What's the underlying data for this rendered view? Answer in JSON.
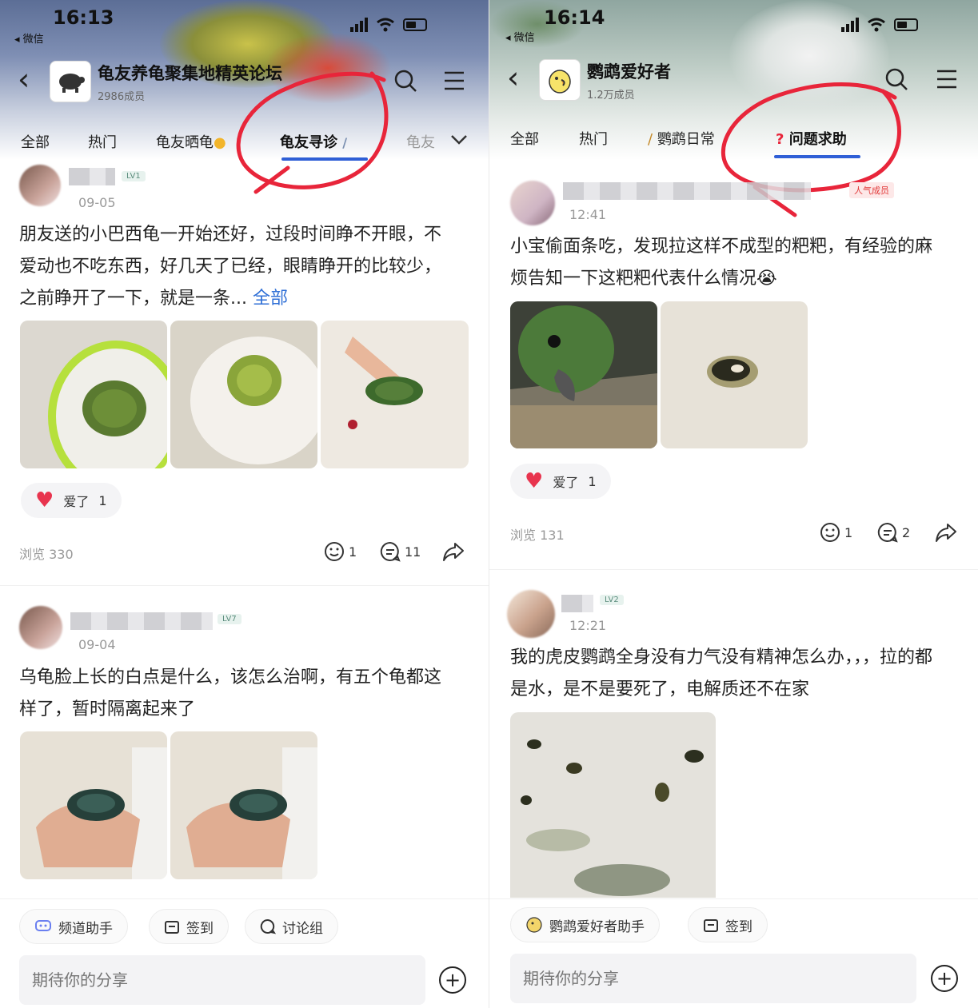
{
  "left": {
    "status": {
      "time": "16:13",
      "back_app": "◂ 微信"
    },
    "group": {
      "name": "龟友养龟聚集地精英论坛",
      "members": "2986成员",
      "avatar_icon": "turtle-logo-icon"
    },
    "tabs": [
      "全部",
      "热门",
      "龟友晒龟",
      "龟友寻诊",
      "龟友"
    ],
    "active_tab_index": 3,
    "posts": [
      {
        "level": "LV1",
        "time": "09-05",
        "text": "朋友送的小巴西龟一开始还好，过段时间睁不开眼，不爱动也不吃东西，好几天了已经，眼睛睁开的比较少，之前睁开了一下，就是一条...",
        "more": "全部",
        "like_label": "爱了",
        "like_count": "1",
        "views": "浏览 330",
        "reactions": "1",
        "comments": "11"
      },
      {
        "level": "LV7",
        "time": "09-04",
        "text": "乌龟脸上长的白点是什么，该怎么治啊，有五个龟都这样了，暂时隔离起来了"
      }
    ],
    "bottom": {
      "chips": [
        "频道助手",
        "签到",
        "讨论组"
      ],
      "input_placeholder": "期待你的分享"
    }
  },
  "right": {
    "status": {
      "time": "16:14",
      "back_app": "◂ 微信"
    },
    "group": {
      "name": "鹦鹉爱好者",
      "members": "1.2万成员",
      "avatar_icon": "parrot-logo-icon"
    },
    "tabs": [
      "全部",
      "热门",
      "鹦鹉日常",
      "问题求助"
    ],
    "active_tab_index": 3,
    "posts": [
      {
        "badge": "人气成员",
        "time": "12:41",
        "text": "小宝偷面条吃，发现拉这样不成型的粑粑，有经验的麻烦告知一下这粑粑代表什么情况😭",
        "like_label": "爱了",
        "like_count": "1",
        "views": "浏览 131",
        "reactions": "1",
        "comments": "2"
      },
      {
        "level": "LV2",
        "time": "12:21",
        "text": "我的虎皮鹦鹉全身没有力气没有精神怎么办，，，拉的都是水，是不是要死了，电解质还不在家"
      }
    ],
    "bottom": {
      "chips": [
        "鹦鹉爱好者助手",
        "签到"
      ],
      "input_placeholder": "期待你的分享"
    }
  },
  "colors": {
    "accent_blue": "#2f5fd6",
    "annotation_red": "#e8253a",
    "heart_red": "#e8344e"
  }
}
